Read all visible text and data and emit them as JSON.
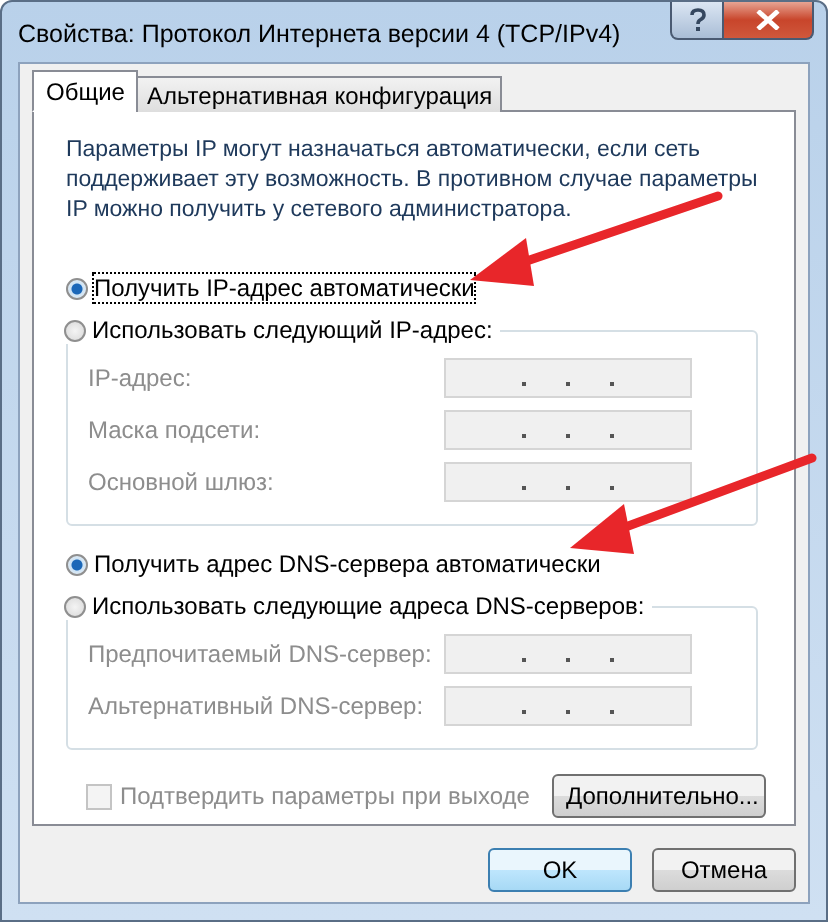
{
  "window": {
    "title": "Свойства: Протокол Интернета версии 4 (TCP/IPv4)"
  },
  "tabs": [
    {
      "label": "Общие",
      "selected": true
    },
    {
      "label": "Альтернативная конфигурация",
      "selected": false
    }
  ],
  "description": "Параметры IP могут назначаться автоматически, если сеть поддерживает эту возможность. В противном случае параметры IP можно получить у сетевого администратора.",
  "sections": [
    {
      "auto_option": {
        "label": "Получить IP-адрес автоматически",
        "selected": true
      },
      "manual_option": {
        "label": "Использовать следующий IP-адрес:",
        "selected": false
      },
      "fields": [
        {
          "label": "IP-адрес:",
          "disabled": true
        },
        {
          "label": "Маска подсети:",
          "disabled": true
        },
        {
          "label": "Основной шлюз:",
          "disabled": true
        }
      ]
    },
    {
      "auto_option": {
        "label": "Получить адрес DNS-сервера автоматически",
        "selected": true
      },
      "manual_option": {
        "label": "Использовать следующие адреса DNS-серверов:",
        "selected": false
      },
      "fields": [
        {
          "label": "Предпочитаемый DNS-сервер:",
          "disabled": true
        },
        {
          "label": "Альтернативный DNS-сервер:",
          "disabled": true
        }
      ]
    }
  ],
  "validate_checkbox": {
    "label": "Подтвердить параметры при выходе",
    "checked": false,
    "disabled": true
  },
  "advanced_button": {
    "label": "Дополнительно..."
  },
  "buttons": [
    {
      "label": "OK",
      "default": true
    },
    {
      "label": "Отмена",
      "default": false
    }
  ]
}
